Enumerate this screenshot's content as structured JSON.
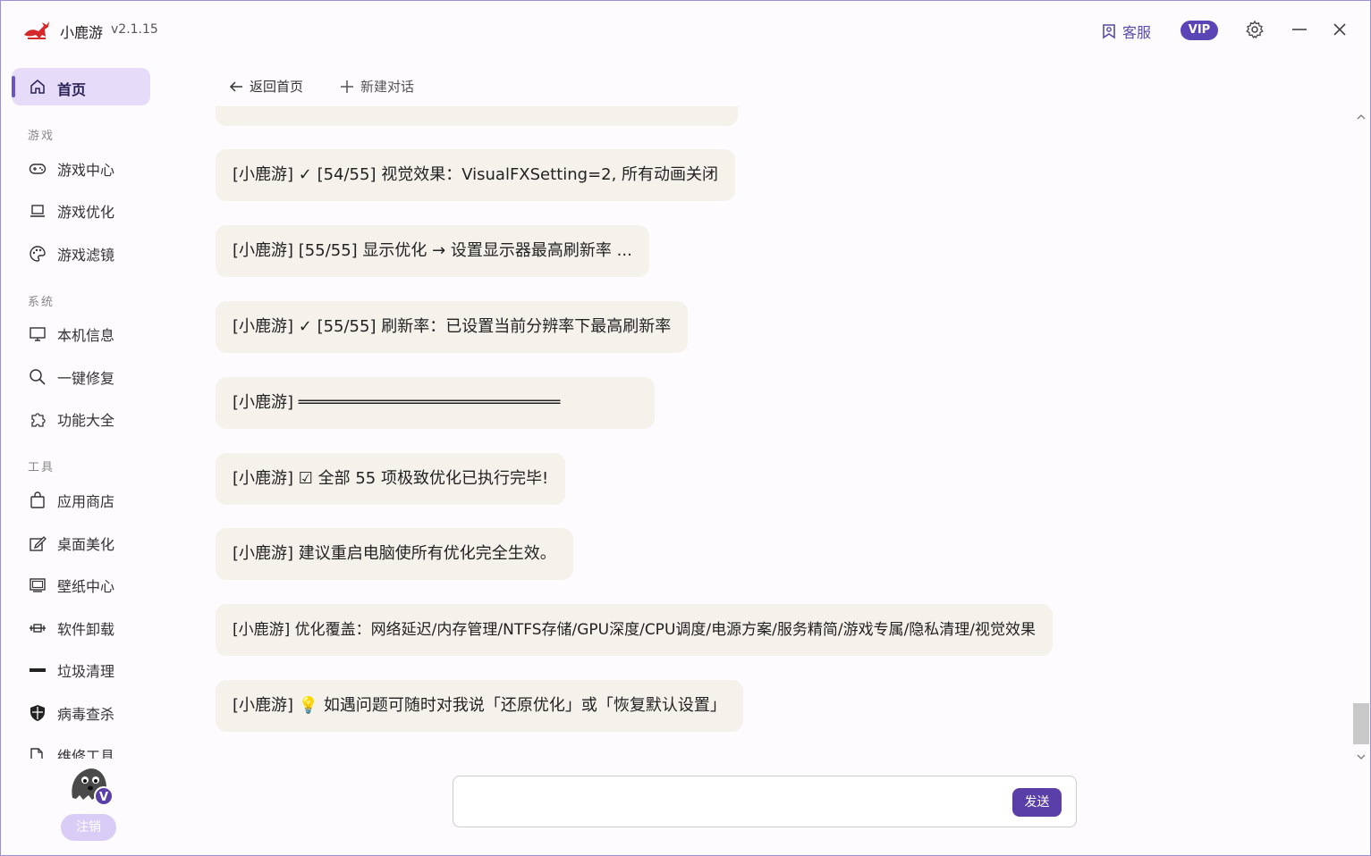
{
  "app": {
    "name": "小鹿游",
    "version": "v2.1.15"
  },
  "header": {
    "service_label": "客服",
    "vip_label": "VIP"
  },
  "sidebar": {
    "home_label": "首页",
    "sections": [
      {
        "title": "游戏",
        "items": [
          "游戏中心",
          "游戏优化",
          "游戏滤镜"
        ]
      },
      {
        "title": "系统",
        "items": [
          "本机信息",
          "一键修复",
          "功能大全"
        ]
      },
      {
        "title": "工具",
        "items": [
          "应用商店",
          "桌面美化",
          "壁纸中心",
          "软件卸载",
          "垃圾清理",
          "病毒查杀",
          "维修工具"
        ]
      }
    ],
    "logout_label": "注销",
    "avatar_badge": "V"
  },
  "toolbar": {
    "back_label": "返回首页",
    "new_chat_label": "新建对话"
  },
  "messages": [
    "[小鹿游] ✓ [54/55] 视觉效果：VisualFXSetting=2, 所有动画关闭",
    "[小鹿游] [55/55] 显示优化 → 设置显示器最高刷新率 ...",
    "[小鹿游] ✓ [55/55] 刷新率：已设置当前分辨率下最高刷新率",
    "[小鹿游] ═══════════════════════════",
    "[小鹿游] ☑ 全部 55 项极致优化已执行完毕!",
    "[小鹿游] 建议重启电脑使所有优化完全生效。",
    "[小鹿游] 优化覆盖：网络延迟/内存管理/NTFS存储/GPU深度/CPU调度/电源方案/服务精简/游戏专属/隐私清理/视觉效果",
    "[小鹿游] 💡 如遇问题可随时对我说「还原优化」或「恢复默认设置」"
  ],
  "input": {
    "placeholder": "",
    "value": "",
    "send_label": "发送"
  }
}
